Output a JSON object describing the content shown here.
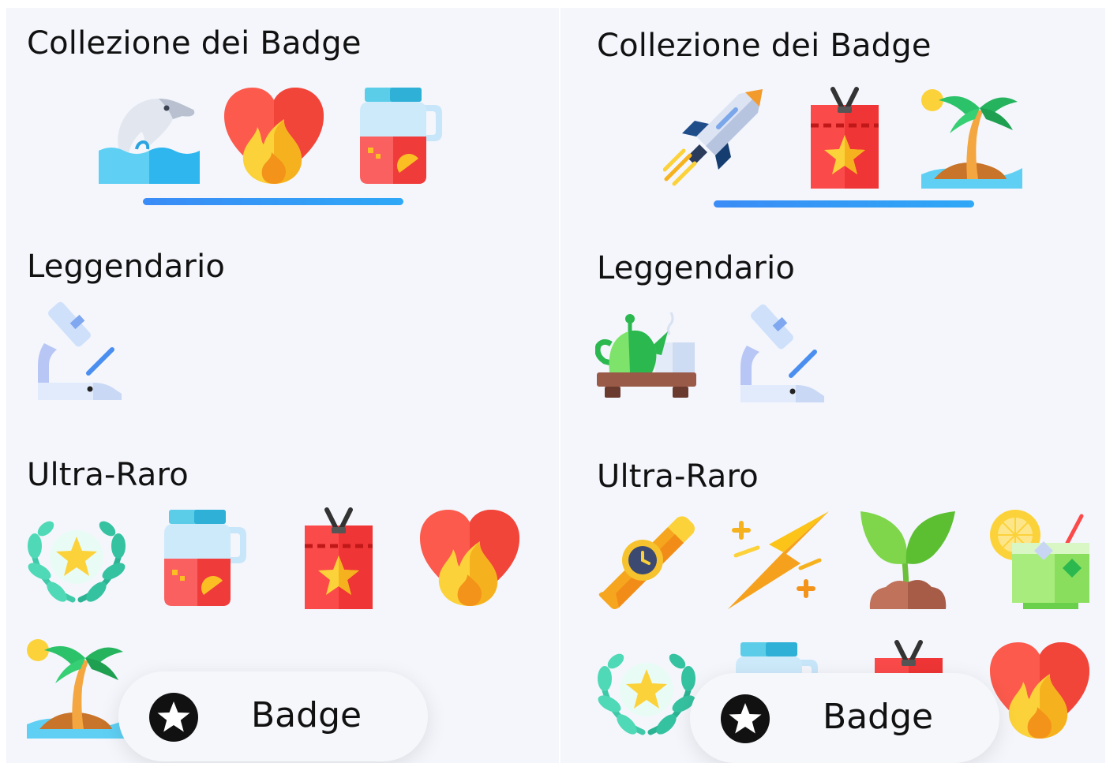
{
  "panels": [
    {
      "collection_title": "Collezione dei Badge",
      "collection_badges": [
        "dolphin-icon",
        "heart-flame-icon",
        "juice-jar-icon"
      ],
      "sections": [
        {
          "title": "Leggendario",
          "badges": [
            "microscope-icon"
          ]
        },
        {
          "title": "Ultra-Raro",
          "badges": [
            "laurel-star-icon",
            "juice-jar-icon",
            "id-badge-icon",
            "heart-flame-icon",
            "palm-island-icon"
          ]
        }
      ],
      "nav": {
        "label": "Badge",
        "icon": "star-circle-icon"
      }
    },
    {
      "collection_title": "Collezione dei Badge",
      "collection_badges": [
        "rocket-icon",
        "id-badge-icon",
        "palm-island-icon"
      ],
      "sections": [
        {
          "title": "Leggendario",
          "badges": [
            "teapot-icon",
            "microscope-icon"
          ]
        },
        {
          "title": "Ultra-Raro",
          "badges": [
            "watch-icon",
            "lightning-icon",
            "sprout-icon",
            "lemonade-icon",
            "laurel-star-icon",
            "juice-jar-icon",
            "id-badge-icon",
            "heart-flame-icon"
          ]
        }
      ],
      "nav": {
        "label": "Badge",
        "icon": "star-circle-icon"
      }
    }
  ]
}
